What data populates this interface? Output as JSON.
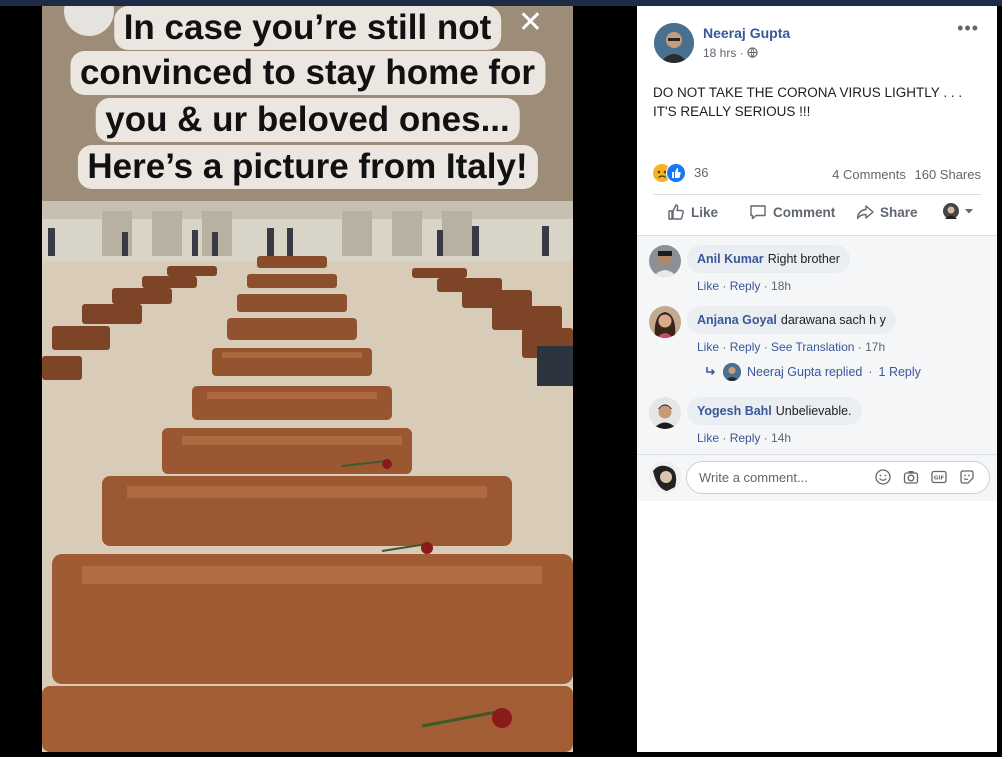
{
  "media": {
    "caption_lines": [
      "In case you’re still not",
      "convinced to stay home for",
      "you & ur beloved ones...",
      "Here’s a picture from Italy!"
    ],
    "close_icon": "close-icon"
  },
  "post": {
    "author": "Neeraj Gupta",
    "time": "18 hrs",
    "audience_icon": "globe-icon",
    "body_lines": [
      "DO NOT TAKE THE CORONA VIRUS LIGHTLY . . .",
      "IT'S REALLY SERIOUS !!!"
    ],
    "reaction_count": "36",
    "comments_count": "4 Comments",
    "shares_count": "160 Shares",
    "reactions": [
      "sad",
      "like"
    ]
  },
  "actions": {
    "like": "Like",
    "comment": "Comment",
    "share": "Share"
  },
  "comments": [
    {
      "name": "Anil Kumar",
      "text": "Right brother",
      "like": "Like",
      "reply": "Reply",
      "time": "18h"
    },
    {
      "name": "Anjana Goyal",
      "text": "darawana sach h y",
      "like": "Like",
      "reply": "Reply",
      "translate": "See Translation",
      "time": "17h"
    },
    {
      "name": "Yogesh Bahl",
      "text": "Unbelievable.",
      "like": "Like",
      "reply": "Reply",
      "time": "14h"
    }
  ],
  "reply_summary": {
    "who": "Neeraj Gupta replied",
    "sep": "·",
    "count": "1 Reply"
  },
  "composer": {
    "placeholder": "Write a comment..."
  },
  "colors": {
    "link": "#385898",
    "like_blue": "#1877f2",
    "sad_yellow": "#f7b125"
  }
}
